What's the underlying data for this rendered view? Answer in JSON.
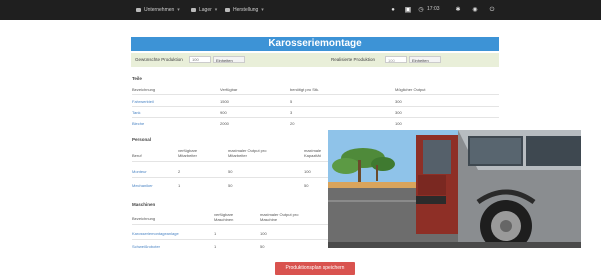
{
  "topbar": {
    "nav": [
      {
        "label": "Unternehmen"
      },
      {
        "label": "Lager"
      },
      {
        "label": "Herstellung"
      }
    ],
    "right_text": "17:03"
  },
  "header_note": "",
  "page": {
    "title": "Karosseriemontage",
    "desired_production_label": "Gewünschte Produktion",
    "desired_production_placeholder": "100",
    "desired_production_unit": "Einheiten",
    "realized_production_label": "Realisierte Produktion",
    "realized_production_value": "100",
    "realized_production_unit": "Einheiten"
  },
  "parts": {
    "title": "Teile",
    "headers": [
      "Bezeichnung",
      "Verfügbar",
      "benötigt pro Stk.",
      "Möglicher Output"
    ],
    "rows": [
      {
        "name": "Fahrwerkteil",
        "available": "1500",
        "needed": "5",
        "output": "300"
      },
      {
        "name": "Tank",
        "available": "900",
        "needed": "3",
        "output": "300"
      },
      {
        "name": "Bleche",
        "available": "2000",
        "needed": "20",
        "output": "100"
      }
    ]
  },
  "personnel": {
    "title": "Personal",
    "headers": [
      "Beruf",
      "verfügbare Mitarbeiter",
      "maximaler Output pro Mitarbeiter",
      "maximale Kapazität"
    ],
    "rows": [
      {
        "name": "Monteur",
        "available": "2",
        "output": "50",
        "capacity": "100"
      },
      {
        "name": "Mechaniker",
        "available": "1",
        "output": "50",
        "capacity": "50"
      }
    ]
  },
  "machines": {
    "title": "Maschinen",
    "headers": [
      "Bezeichnung",
      "verfügbare Maschinen",
      "maximaler Output pro Maschine"
    ],
    "rows": [
      {
        "name": "Karosseriemontageanlage",
        "available": "1",
        "output": "100"
      },
      {
        "name": "Schweißroboter",
        "available": "1",
        "output": "50"
      }
    ]
  },
  "save_button_label": "Produktionsplan speichern",
  "colors": {
    "topbar": "#1f1f1f",
    "title_bar": "#3d93d6",
    "production_bar": "#e9efd9",
    "link": "#4a84c4",
    "save_button": "#d9534f"
  },
  "icons": [
    "home-icon",
    "truck-icon",
    "gear-icon",
    "user-icon",
    "power-icon"
  ]
}
